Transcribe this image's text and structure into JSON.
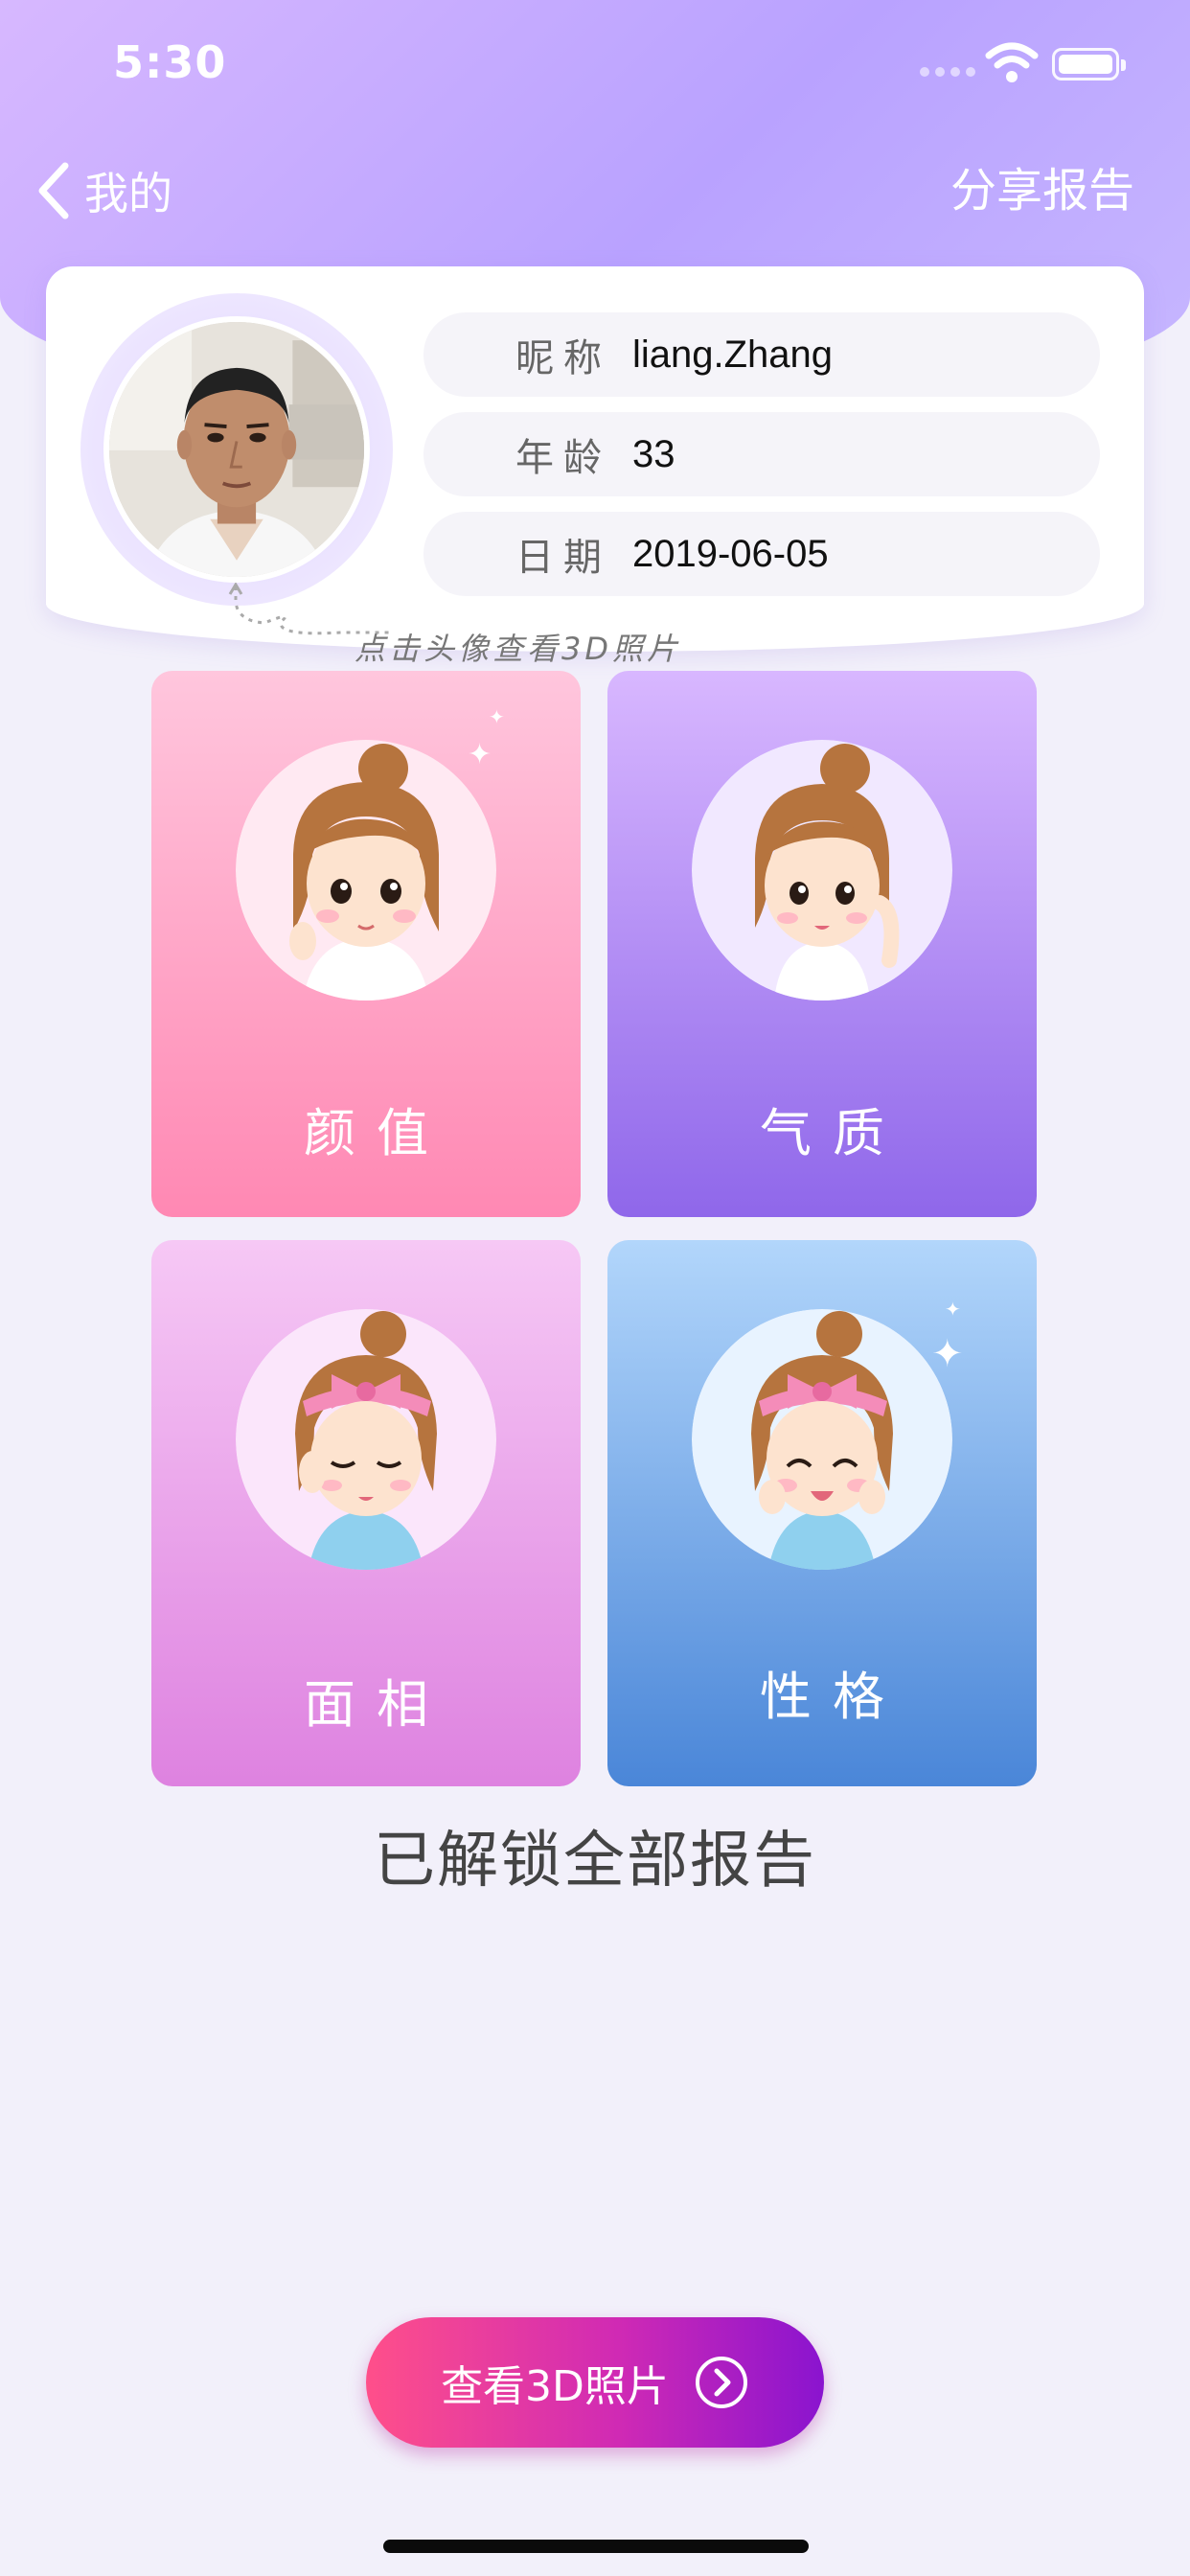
{
  "status_bar": {
    "time": "5:30"
  },
  "nav": {
    "back_label": "我的",
    "share_label": "分享报告"
  },
  "profile": {
    "fields": [
      {
        "label": "昵称",
        "value": "liang.Zhang"
      },
      {
        "label": "年龄",
        "value": "33"
      },
      {
        "label": "日期",
        "value": "2019-06-05"
      }
    ],
    "hint": "点击头像查看3D照片"
  },
  "cards": [
    {
      "title": "颜值",
      "color": "#ff88b3"
    },
    {
      "title": "气质",
      "color": "#8f67ea"
    },
    {
      "title": "面相",
      "color": "#de82e0"
    },
    {
      "title": "性格",
      "color": "#4a86d8"
    }
  ],
  "unlocked_text": "已解锁全部报告",
  "view3d_button": {
    "label": "查看3D照片"
  },
  "colors": {
    "header_accent": "#b9a2ff",
    "button_start": "#ff4f8a",
    "button_end": "#8a14cf",
    "background": "#f2f0fa"
  }
}
